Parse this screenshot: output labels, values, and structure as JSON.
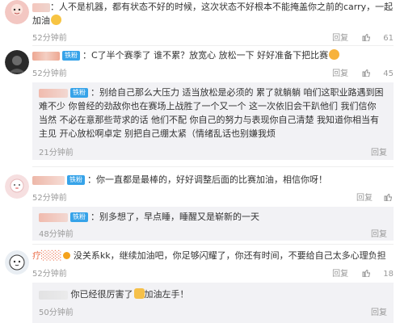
{
  "c1": {
    "text": "：人不是机器，都有状态不好的时候，这次状态不好根本不能掩盖你之前的carry，一起加油",
    "time": "52分钟前",
    "reply": "回复",
    "likes": "61"
  },
  "c2": {
    "badge": "铁粉",
    "text": "：C了半个赛季了 谁不累？放宽心 放松一下 好好准备下把比赛",
    "time": "52分钟前",
    "reply": "回复",
    "likes": "45",
    "sub": {
      "badge": "铁粉",
      "text": "：别给自己那么大压力 适当放松是必须的 累了就躺躺 咱们这职业路遇到困难不少 你曾经的劲敌你也在赛场上战胜了一个又一个 这一次依旧会干趴他们 我们信你 当然 不必在意那些苛求的话 他们不配 你自己的努力与表现你自己清楚 我知道你相当有主见 开心放松啊卓定 别把自己绷太紧（情绪乱话也别嫌我烦",
      "time": "21分钟前",
      "reply": "回复"
    }
  },
  "c3": {
    "badge": "铁粉",
    "text": "：你一直都是最棒的，好好调整后面的比赛加油，相信你呀！",
    "time": "52分钟前",
    "reply": "回复",
    "sub": {
      "badge": "铁粉",
      "text": "：别多想了，早点睡，睡醒又是崭新的一天",
      "time": "48分钟前",
      "reply": "回复"
    }
  },
  "c4": {
    "name": "疗░░░",
    "text": "没关系kk，继续加油吧，你足够闪耀了，你还有时间，不要给自己太多心理负担",
    "time": "52分钟前",
    "reply": "回复",
    "likes": "18",
    "sub": {
      "text": "你已经很厉害了",
      "text2": "加油左手！",
      "time": "50分钟前",
      "reply": "回复"
    }
  },
  "colors": {
    "username": "#eb7350",
    "badge": "#36a3e9",
    "reply_bg": "#f2f2f5",
    "meta": "#9a9a9a"
  }
}
